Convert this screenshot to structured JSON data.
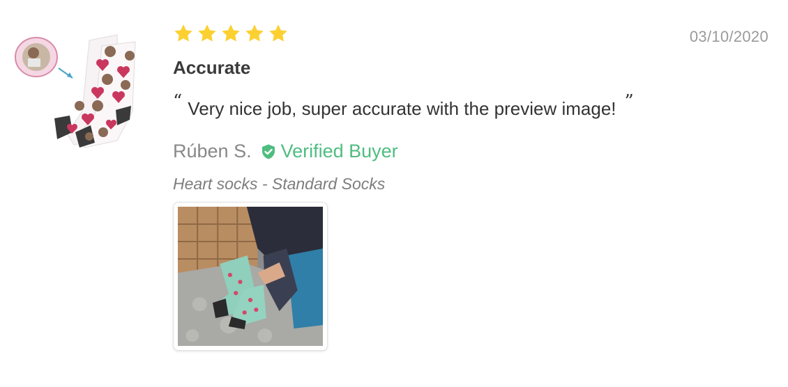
{
  "review": {
    "rating": 5,
    "rating_max": 5,
    "date": "03/10/2020",
    "title": "Accurate",
    "quote_open": "“",
    "body": "Very nice job, super accurate with the preview image!",
    "quote_close": "”",
    "author": "Rúben S.",
    "verified_label": "Verified Buyer",
    "variant": "Heart socks - Standard Socks"
  },
  "colors": {
    "star": "#fcd031",
    "verified": "#4fbd80",
    "date": "#9a9a9a"
  },
  "icons": {
    "star": "star-icon",
    "verified": "shield-check-icon"
  }
}
